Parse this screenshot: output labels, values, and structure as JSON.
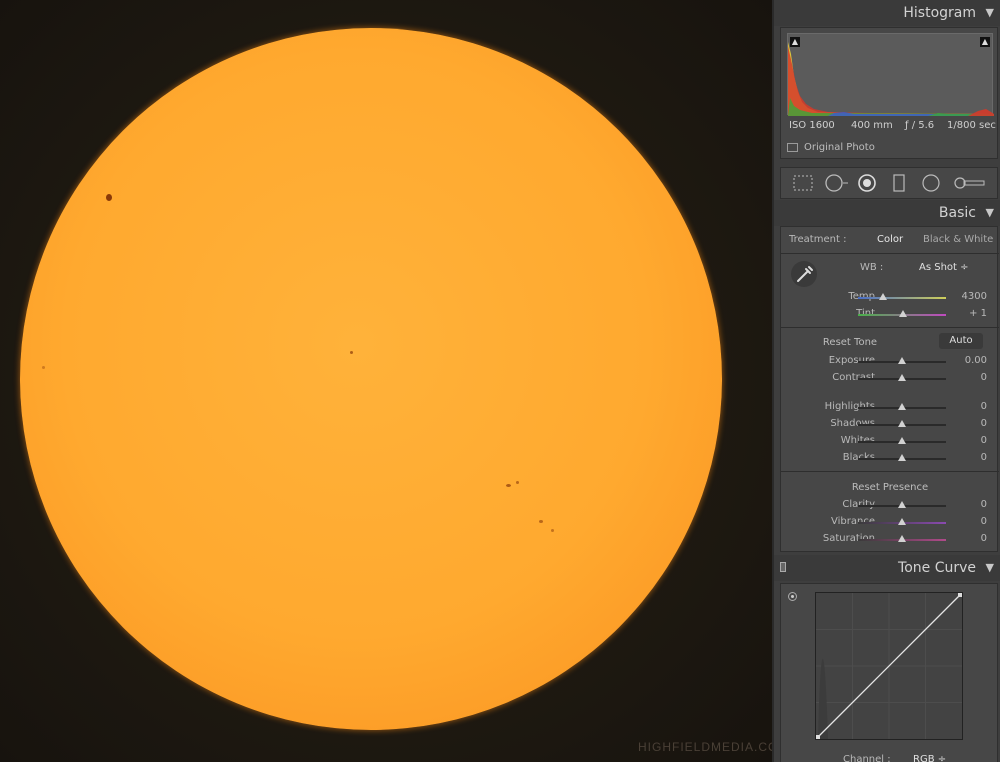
{
  "watermark": "HIGHFIELDMEDIA.COM",
  "histogram": {
    "title": "Histogram",
    "iso": "ISO 1600",
    "focal": "400 mm",
    "aperture": "ƒ / 5.6",
    "shutter": "1/800 sec",
    "original_photo": "Original Photo"
  },
  "basic": {
    "title": "Basic",
    "treatment_label": "Treatment :",
    "treatment_color": "Color",
    "treatment_bw": "Black & White",
    "wb_label": "WB :",
    "wb_value": "As Shot ÷",
    "reset_tone": "Reset Tone",
    "auto": "Auto",
    "reset_presence": "Reset Presence",
    "sliders": [
      {
        "label": "Temp",
        "value": "4300",
        "pos": 0.28
      },
      {
        "label": "Tint",
        "value": "+ 1",
        "pos": 0.51
      },
      {
        "label": "Exposure",
        "value": "0.00",
        "pos": 0.5
      },
      {
        "label": "Contrast",
        "value": "0",
        "pos": 0.5
      },
      {
        "label": "Highlights",
        "value": "0",
        "pos": 0.5
      },
      {
        "label": "Shadows",
        "value": "0",
        "pos": 0.5
      },
      {
        "label": "Whites",
        "value": "0",
        "pos": 0.5
      },
      {
        "label": "Blacks",
        "value": "0",
        "pos": 0.5
      },
      {
        "label": "Clarity",
        "value": "0",
        "pos": 0.5
      },
      {
        "label": "Vibrance",
        "value": "0",
        "pos": 0.5
      },
      {
        "label": "Saturation",
        "value": "0",
        "pos": 0.5
      }
    ]
  },
  "tone_curve": {
    "title": "Tone Curve",
    "channel_label": "Channel :",
    "channel_value": "RGB ÷"
  },
  "colors": {
    "panel_bg": "#3e3e3e",
    "sun": "#ffa92f",
    "background": "#1b1712"
  }
}
